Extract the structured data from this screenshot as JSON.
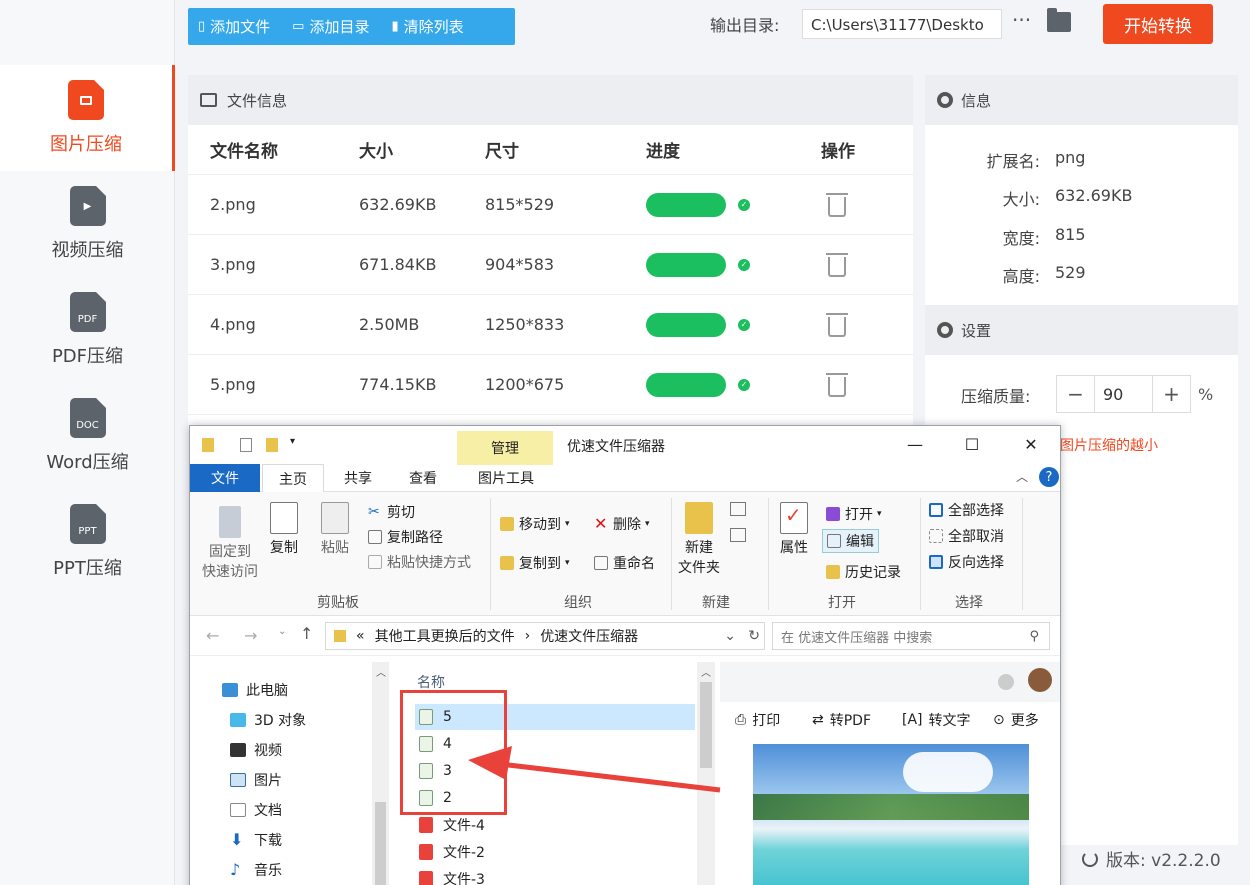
{
  "sidebar": {
    "items": [
      {
        "label": "图片压缩",
        "icon": "image-file-icon"
      },
      {
        "label": "视频压缩",
        "icon": "video-file-icon"
      },
      {
        "label": "PDF压缩",
        "icon": "pdf-file-icon",
        "tag": "PDF"
      },
      {
        "label": "Word压缩",
        "icon": "doc-file-icon",
        "tag": "DOC"
      },
      {
        "label": "PPT压缩",
        "icon": "ppt-file-icon",
        "tag": "PPT"
      }
    ],
    "active_index": 0
  },
  "toolbar": {
    "add_file": "添加文件",
    "add_dir": "添加目录",
    "clear_list": "清除列表",
    "output_label": "输出目录:",
    "output_value": "C:\\Users\\31177\\Deskto",
    "more": "···",
    "start": "开始转换"
  },
  "file_panel": {
    "title": "文件信息",
    "columns": [
      "文件名称",
      "大小",
      "尺寸",
      "进度",
      "操作"
    ],
    "rows": [
      {
        "name": "2.png",
        "size": "632.69KB",
        "dim": "815*529",
        "progress": 1.0
      },
      {
        "name": "3.png",
        "size": "671.84KB",
        "dim": "904*583",
        "progress": 1.0
      },
      {
        "name": "4.png",
        "size": "2.50MB",
        "dim": "1250*833",
        "progress": 1.0
      },
      {
        "name": "5.png",
        "size": "774.15KB",
        "dim": "1200*675",
        "progress": 1.0
      }
    ]
  },
  "info_panel": {
    "title": "信息",
    "ext_key": "扩展名:",
    "ext_val": "png",
    "size_key": "大小:",
    "size_val": "632.69KB",
    "width_key": "宽度:",
    "width_val": "815",
    "height_key": "高度:",
    "height_val": "529"
  },
  "settings": {
    "title": "设置",
    "quality_label": "压缩质量:",
    "quality_value": "90",
    "minus": "−",
    "plus": "+",
    "unit": "%",
    "hint": "图片压缩的越小"
  },
  "version": "版本:  v2.2.2.0",
  "explorer": {
    "manage": "管理",
    "title": "优速文件压缩器",
    "tabs": [
      "文件",
      "主页",
      "共享",
      "查看",
      "图片工具"
    ],
    "clipboard": {
      "pin": "固定到\n快速访问",
      "copy": "复制",
      "paste": "粘贴",
      "cut": "剪切",
      "copy_path": "复制路径",
      "paste_shortcut": "粘贴快捷方式",
      "group": "剪贴板"
    },
    "organize": {
      "move_to": "移动到",
      "copy_to": "复制到",
      "delete": "删除",
      "rename": "重命名",
      "group": "组织"
    },
    "new": {
      "new_folder": "新建\n文件夹",
      "group": "新建"
    },
    "open": {
      "properties": "属性",
      "open": "打开",
      "edit": "编辑",
      "history": "历史记录",
      "group": "打开"
    },
    "select": {
      "all": "全部选择",
      "none": "全部取消",
      "invert": "反向选择",
      "group": "选择"
    },
    "address": [
      "«",
      "其他工具更换后的文件",
      "›",
      "优速文件压缩器"
    ],
    "search_placeholder": "在 优速文件压缩器 中搜索",
    "tree": [
      "此电脑",
      "3D 对象",
      "视频",
      "图片",
      "文档",
      "下载",
      "音乐"
    ],
    "list_header": "名称",
    "files": [
      "5",
      "4",
      "3",
      "2",
      "文件-4",
      "文件-2",
      "文件-3"
    ],
    "preview": {
      "print": "打印",
      "to_pdf": "转PDF",
      "to_text": "转文字",
      "more": "更多"
    }
  }
}
